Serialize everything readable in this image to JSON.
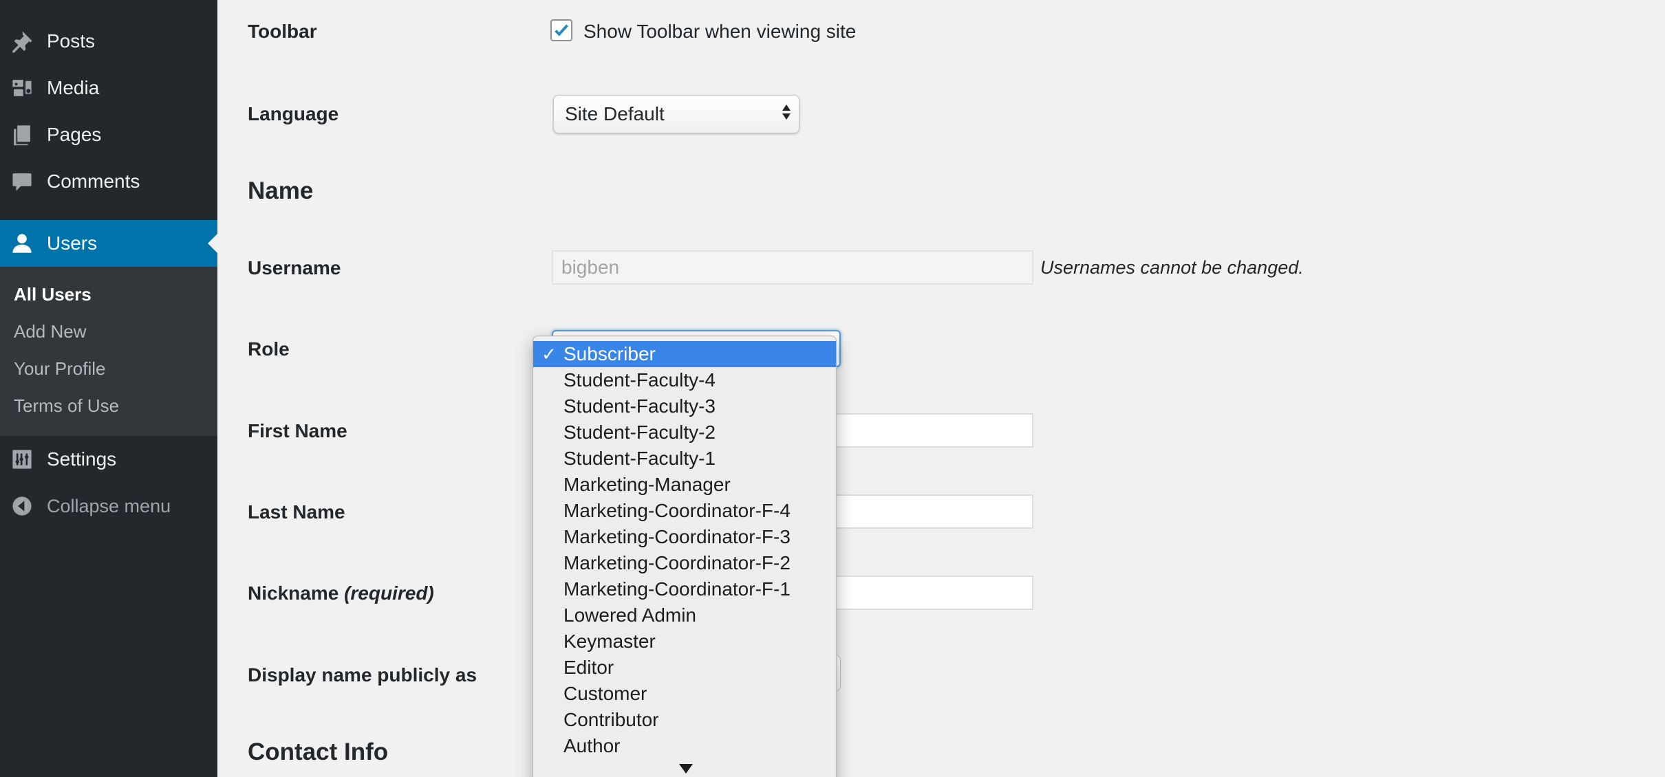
{
  "sidebar": {
    "items": [
      {
        "label": "Posts",
        "icon": "pin-icon"
      },
      {
        "label": "Media",
        "icon": "media-icon"
      },
      {
        "label": "Pages",
        "icon": "pages-icon"
      },
      {
        "label": "Comments",
        "icon": "comment-icon"
      },
      {
        "label": "Users",
        "icon": "user-icon"
      },
      {
        "label": "Settings",
        "icon": "settings-icon"
      },
      {
        "label": "Collapse menu",
        "icon": "collapse-icon"
      }
    ],
    "submenu": [
      "All Users",
      "Add New",
      "Your Profile",
      "Terms of Use"
    ],
    "active_color": "#0073aa"
  },
  "form": {
    "toolbar": {
      "label": "Toolbar",
      "checkbox_label": "Show Toolbar when viewing site",
      "checked": true
    },
    "language": {
      "label": "Language",
      "value": "Site Default"
    },
    "name_section": "Name",
    "username": {
      "label": "Username",
      "value": "bigben",
      "hint": "Usernames cannot be changed."
    },
    "role": {
      "label": "Role"
    },
    "first_name": {
      "label": "First Name",
      "value": ""
    },
    "last_name": {
      "label": "Last Name",
      "value": ""
    },
    "nickname": {
      "label": "Nickname",
      "required": "(required)",
      "value": ""
    },
    "display_name": {
      "label": "Display name publicly as"
    },
    "contact_section": "Contact Info"
  },
  "role_dropdown": {
    "selected": "Subscriber",
    "check_mark": "✓",
    "options": [
      "Subscriber",
      "Student-Faculty-4",
      "Student-Faculty-3",
      "Student-Faculty-2",
      "Student-Faculty-1",
      "Marketing-Manager",
      "Marketing-Coordinator-F-4",
      "Marketing-Coordinator-F-3",
      "Marketing-Coordinator-F-2",
      "Marketing-Coordinator-F-1",
      "Lowered Admin",
      "Keymaster",
      "Editor",
      "Customer",
      "Contributor",
      "Author"
    ],
    "highlight_color": "#3a86e8"
  }
}
